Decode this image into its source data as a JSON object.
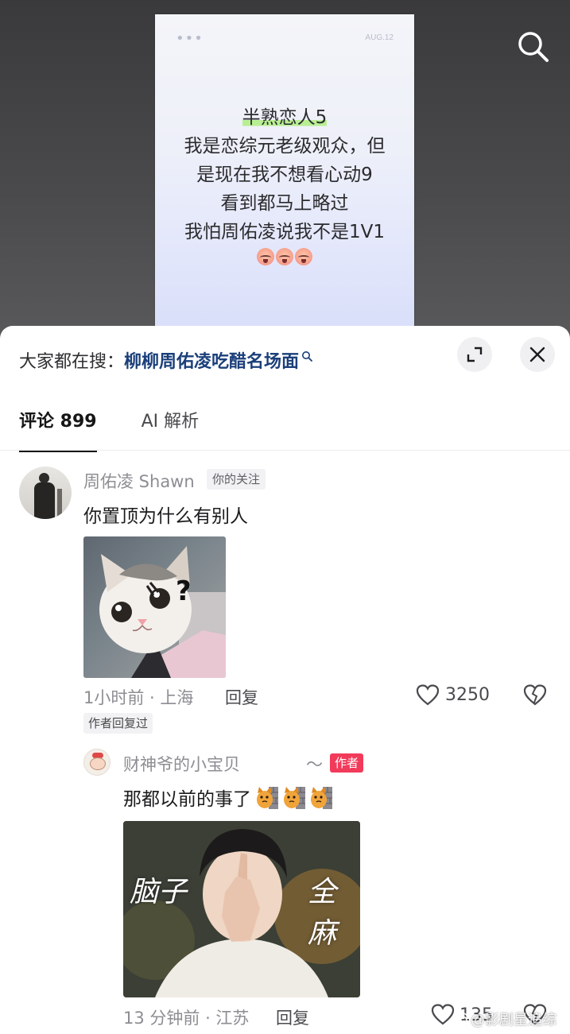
{
  "post": {
    "date": "AUG.12",
    "lines": [
      "半熟恋人5",
      "我是恋综元老级观众，但",
      "是现在我不想看心动9",
      "看到都马上略过",
      "我怕周佑凌说我不是1V1"
    ],
    "highlight_color": "#b8ef93"
  },
  "hot_search": {
    "prefix": "大家都在搜：",
    "query": "柳柳周佑凌吃醋名场面"
  },
  "tabs": {
    "comments": "评论 899",
    "ai": "AI 解析"
  },
  "comment_1": {
    "author": "周佑凌 Shawn",
    "badge": "你的关注",
    "text": "你置顶为什么有别人",
    "meta": "1小时前 · 上海",
    "reply_label": "回复",
    "likes": "3250",
    "author_replied": "作者回复过"
  },
  "comment_2": {
    "author": "财神爷的小宝贝",
    "tilde": "～",
    "badge": "作者",
    "text": "那都以前的事了",
    "image_text_left": "脑子",
    "image_text_right": "全麻",
    "meta": "13 分钟前 · 江苏",
    "reply_label": "回复",
    "likes": "135"
  },
  "watermark": "@影剧星追综",
  "colors": {
    "link_blue": "#1b3f7a",
    "author_badge": "#f23a5a",
    "muted_text": "#8d8d93"
  },
  "icons": {
    "search": "search-icon",
    "expand": "expand-icon",
    "close": "close-icon",
    "like": "heart-icon",
    "dislike": "broken-heart-icon"
  }
}
